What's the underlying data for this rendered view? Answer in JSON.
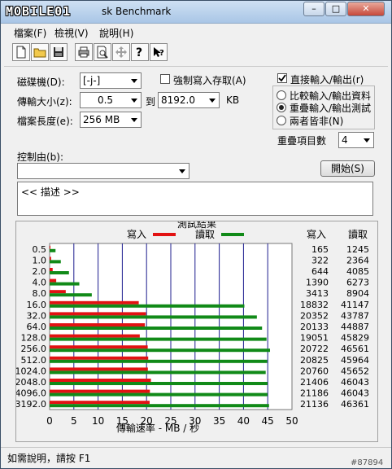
{
  "window": {
    "logo": "MOBILE01",
    "title": "sk Benchmark",
    "btn_min": "–",
    "btn_max": "□",
    "btn_close": "✕"
  },
  "menu": [
    "檔案(F)",
    "檢視(V)",
    "說明(H)"
  ],
  "settings": {
    "drive_label": "磁碟機(D):",
    "drive_value": "[-j-]",
    "transfer_label": "傳輸大小(z):",
    "transfer_from": "0.5",
    "to_label": "到",
    "transfer_to": "8192.0",
    "kb_label": "KB",
    "length_label": "檔案長度(e):",
    "length_value": "256 MB",
    "force_write_label": "強制寫入存取(A)",
    "direct_io_label": "直接輸入/輸出(r)",
    "radio_compare": "比較輸入/輸出資料",
    "radio_overlap": "重疊輸入/輸出測試",
    "radio_neither": "兩者皆非(N)",
    "queue_label": "重疊項目數",
    "queue_value": "4",
    "control_label": "控制由(b):",
    "start_button": "開始(S)",
    "description": "<<   描述   >>"
  },
  "results": {
    "title": "測試結果",
    "write_label": "寫入",
    "read_label": "讀取",
    "col_write": "寫入",
    "col_read": "讀取",
    "axis_label": "傳輸速率 - MB / 秒",
    "colors": {
      "write": "#e21212",
      "read": "#118a18",
      "grid": "#1c1c8e"
    }
  },
  "chart_data": {
    "type": "bar",
    "orientation": "horizontal",
    "categories": [
      "0.5",
      "1.0",
      "2.0",
      "4.0",
      "8.0",
      "16.0",
      "32.0",
      "64.0",
      "128.0",
      "256.0",
      "512.0",
      "1024.0",
      "2048.0",
      "4096.0",
      "3192.0"
    ],
    "xlabel": "傳輸速率 - MB / 秒",
    "xlim": [
      0,
      50
    ],
    "xticks": [
      0,
      5,
      10,
      15,
      20,
      25,
      30,
      35,
      40,
      45,
      50
    ],
    "legend_position": "top",
    "series": [
      {
        "name": "寫入",
        "color": "#e21212",
        "values": [
          0.16,
          0.31,
          0.63,
          1.36,
          3.33,
          18.39,
          19.88,
          19.66,
          18.6,
          20.24,
          20.34,
          20.27,
          20.9,
          20.69,
          20.64
        ],
        "labels": [
          "165",
          "322",
          "644",
          "1390",
          "3413",
          "18832",
          "20352",
          "20133",
          "19051",
          "20722",
          "20825",
          "20760",
          "21406",
          "21186",
          "21136"
        ]
      },
      {
        "name": "讀取",
        "color": "#118a18",
        "values": [
          1.22,
          2.31,
          3.99,
          6.13,
          8.7,
          40.18,
          42.76,
          43.83,
          44.75,
          45.47,
          44.89,
          44.58,
          44.96,
          44.96,
          45.27
        ],
        "labels": [
          "1245",
          "2364",
          "4085",
          "6273",
          "8904",
          "41147",
          "43787",
          "44887",
          "45829",
          "46561",
          "45964",
          "45652",
          "46043",
          "46043",
          "46361"
        ]
      }
    ]
  },
  "status": {
    "help_text": "如需說明，請按 F1",
    "watermark": "#87894"
  }
}
